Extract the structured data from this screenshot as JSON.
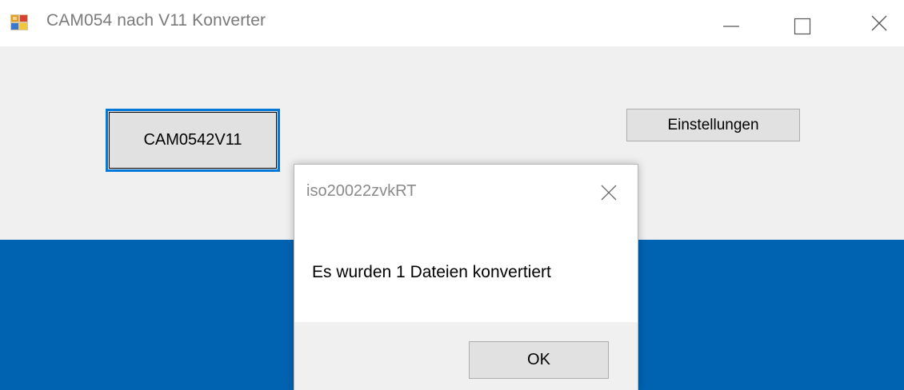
{
  "window": {
    "title": "CAM054 nach V11 Konverter",
    "icon": "app-form-icon",
    "controls": [
      "minimize-icon",
      "maximize-icon",
      "close-icon"
    ]
  },
  "main": {
    "convert_button_label": "CAM0542V11",
    "settings_button_label": "Einstellungen"
  },
  "dialog": {
    "title": "iso20022zvkRT",
    "message": "Es wurden 1 Dateien konvertiert",
    "ok_label": "OK"
  },
  "colors": {
    "client_background": "#f0f0f0",
    "lower_panel": "#0063b1",
    "focus_border": "#0078d7",
    "button_face": "#e1e1e1"
  }
}
